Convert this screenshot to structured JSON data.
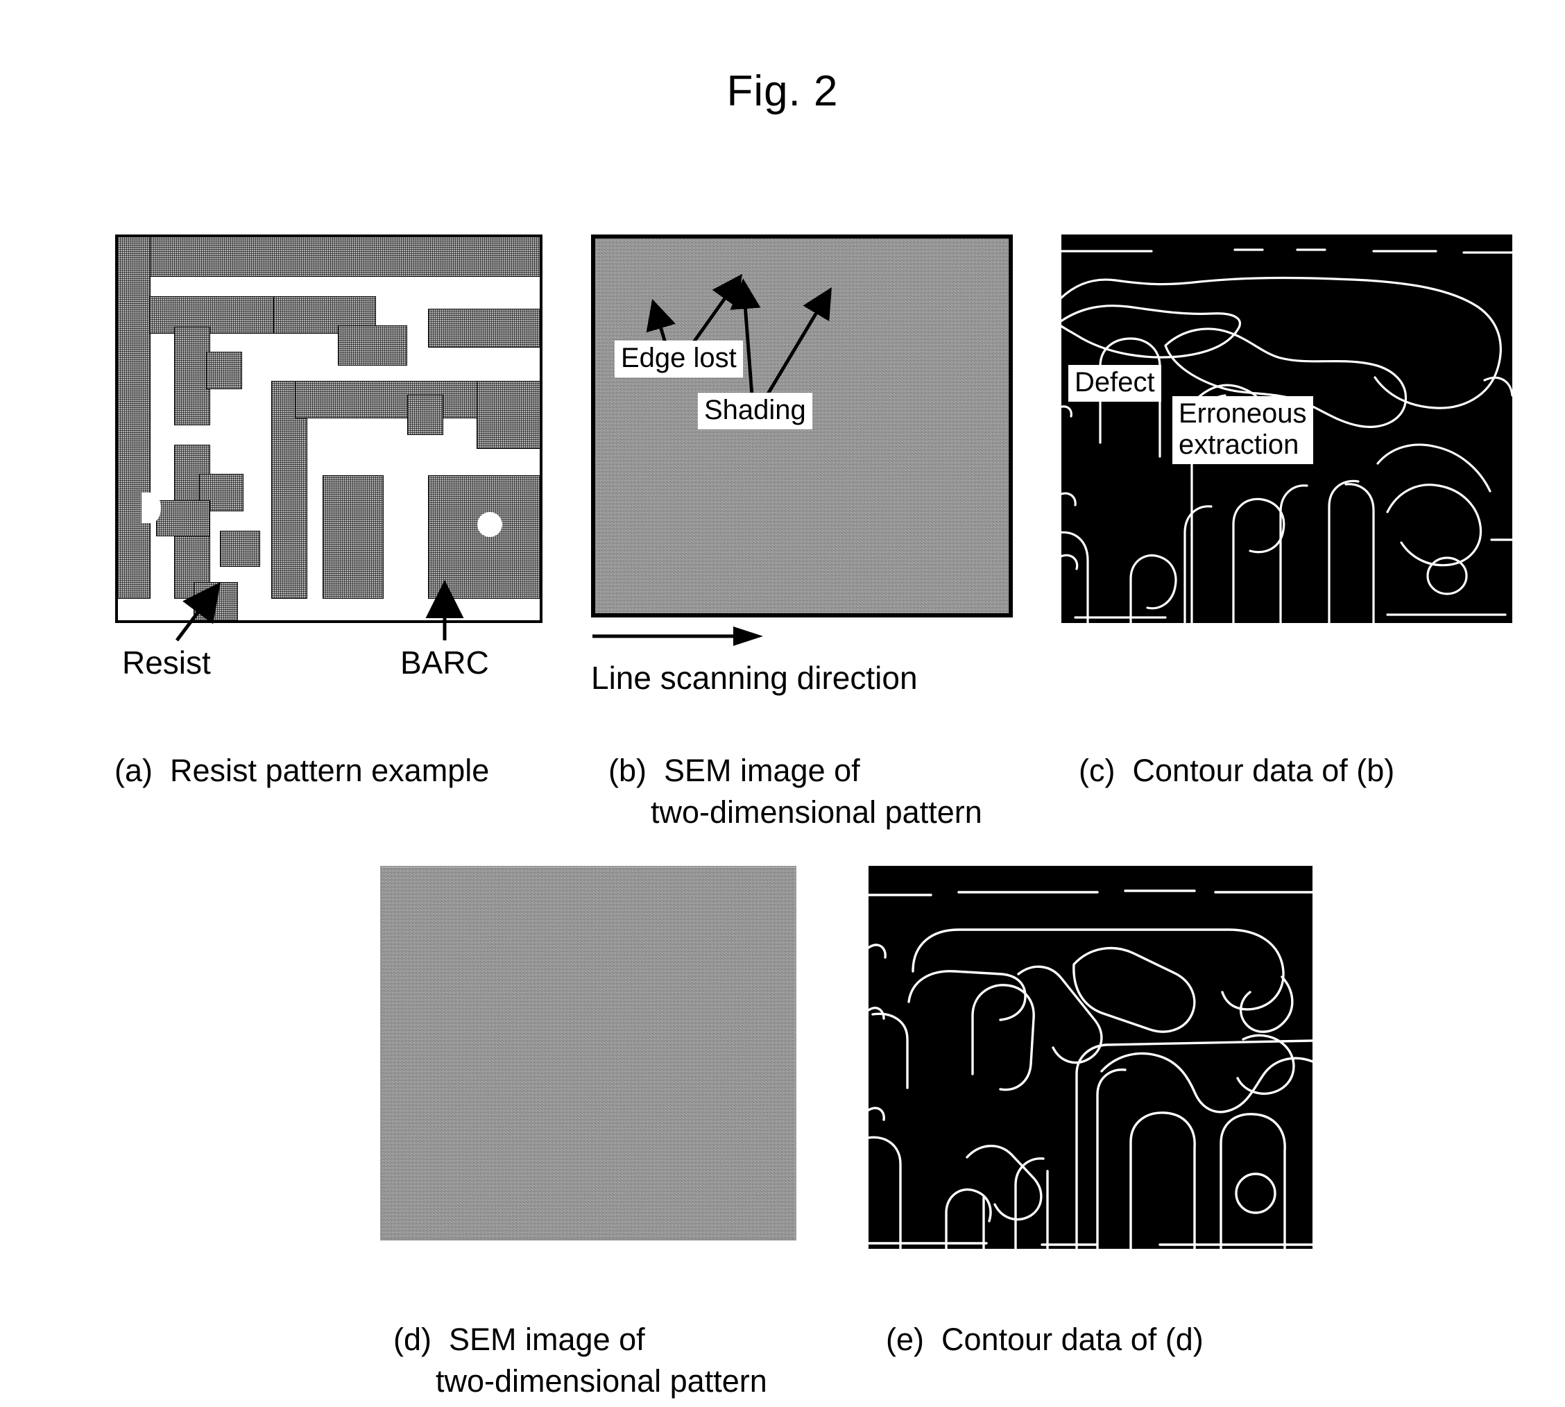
{
  "figure": {
    "title": "Fig. 2"
  },
  "panel_a": {
    "id": "a",
    "caption_tag": "(a)",
    "caption_text": "Resist pattern example",
    "label_resist": "Resist",
    "label_barc": "BARC",
    "legend_colors": {
      "resist_fill": "#b3b3b3",
      "barc_fill": "#ffffff",
      "outline": "#000000"
    }
  },
  "panel_b": {
    "id": "b",
    "caption_tag": "(b)",
    "caption_line1": "SEM image of",
    "caption_line2": "two-dimensional pattern",
    "callout_edge_lost": "Edge lost",
    "callout_shading": "Shading",
    "scan_label": "Line scanning direction",
    "image_fill": "#a8a8a8"
  },
  "panel_c": {
    "id": "c",
    "caption_tag": "(c)",
    "caption_text": "Contour data of (b)",
    "callout_defect": "Defect",
    "callout_erroneous_line1": "Erroneous",
    "callout_erroneous_line2": "extraction",
    "background": "#000000",
    "contour_color": "#ffffff"
  },
  "panel_d": {
    "id": "d",
    "caption_tag": "(d)",
    "caption_line1": "SEM image of",
    "caption_line2": "two-dimensional pattern",
    "image_fill": "#a8a8a8"
  },
  "panel_e": {
    "id": "e",
    "caption_tag": "(e)",
    "caption_text": "Contour data of (d)",
    "background": "#000000",
    "contour_color": "#ffffff"
  }
}
